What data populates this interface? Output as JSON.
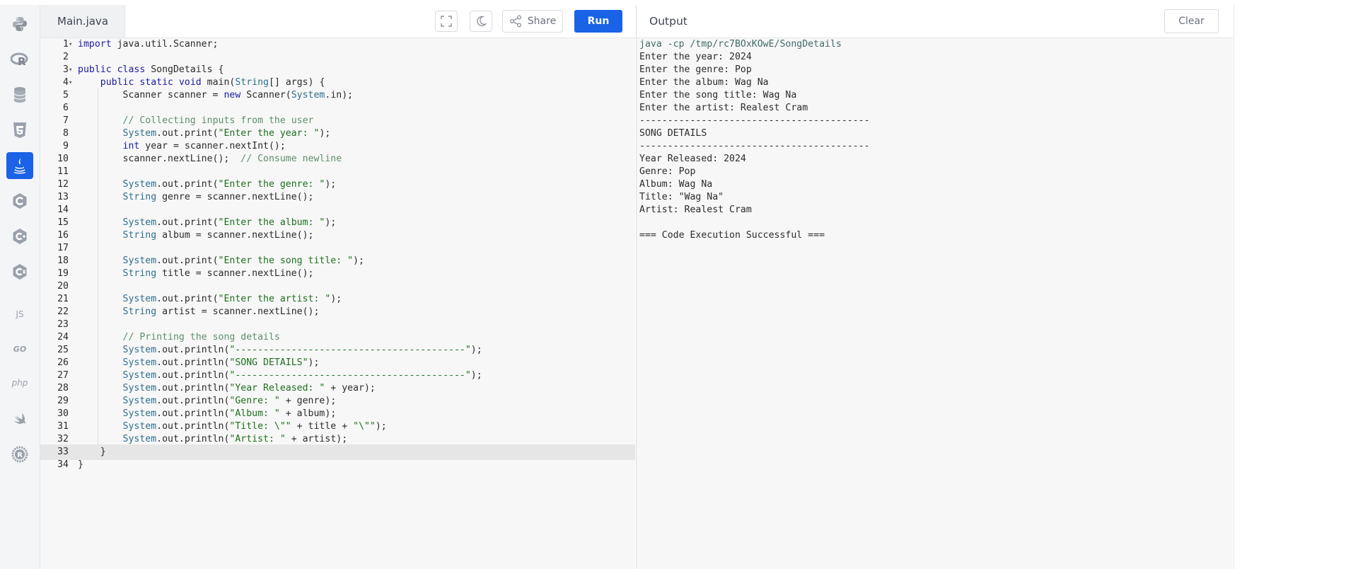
{
  "sidebar": {
    "languages": [
      {
        "icon": "python-icon"
      },
      {
        "icon": "r-icon"
      },
      {
        "icon": "sql-database-icon"
      },
      {
        "icon": "html5-icon"
      },
      {
        "icon": "java-icon",
        "active": true
      },
      {
        "icon": "c-icon"
      },
      {
        "icon": "cpp-icon"
      },
      {
        "icon": "csharp-icon"
      },
      {
        "icon": "js-icon",
        "label": "JS"
      },
      {
        "icon": "go-icon",
        "label": "GO"
      },
      {
        "icon": "php-icon",
        "label": "php"
      },
      {
        "icon": "swift-icon"
      },
      {
        "icon": "rust-icon"
      }
    ]
  },
  "editor": {
    "file_tab": "Main.java",
    "share_label": "Share",
    "run_label": "Run",
    "highlighted_line": 33,
    "lines": [
      "import java.util.Scanner;",
      "",
      "public class SongDetails {",
      "    public static void main(String[] args) {",
      "        Scanner scanner = new Scanner(System.in);",
      "",
      "        // Collecting inputs from the user",
      "        System.out.print(\"Enter the year: \");",
      "        int year = scanner.nextInt();",
      "        scanner.nextLine();  // Consume newline",
      "",
      "        System.out.print(\"Enter the genre: \");",
      "        String genre = scanner.nextLine();",
      "",
      "        System.out.print(\"Enter the album: \");",
      "        String album = scanner.nextLine();",
      "",
      "        System.out.print(\"Enter the song title: \");",
      "        String title = scanner.nextLine();",
      "",
      "        System.out.print(\"Enter the artist: \");",
      "        String artist = scanner.nextLine();",
      "",
      "        // Printing the song details",
      "        System.out.println(\"-----------------------------------------\");",
      "        System.out.println(\"SONG DETAILS\");",
      "        System.out.println(\"-----------------------------------------\");",
      "        System.out.println(\"Year Released: \" + year);",
      "        System.out.println(\"Genre: \" + genre);",
      "        System.out.println(\"Album: \" + album);",
      "        System.out.println(\"Title: \\\"\" + title + \"\\\"\");",
      "        System.out.println(\"Artist: \" + artist);",
      "    }",
      "}"
    ]
  },
  "output": {
    "title": "Output",
    "clear_label": "Clear",
    "lines": [
      "java -cp /tmp/rc7BOxKOwE/SongDetails",
      "Enter the year: 2024",
      "Enter the genre: Pop",
      "Enter the album: Wag Na",
      "Enter the song title: Wag Na",
      "Enter the artist: Realest Cram",
      "-----------------------------------------",
      "SONG DETAILS",
      "-----------------------------------------",
      "Year Released: 2024",
      "Genre: Pop",
      "Album: Wag Na",
      "Title: \"Wag Na\"",
      "Artist: Realest Cram",
      "",
      "=== Code Execution Successful ==="
    ]
  },
  "colors": {
    "accent": "#1a62e6",
    "sidebar_bg": "#f4f5f7",
    "editor_bg": "#f7f7f7"
  }
}
